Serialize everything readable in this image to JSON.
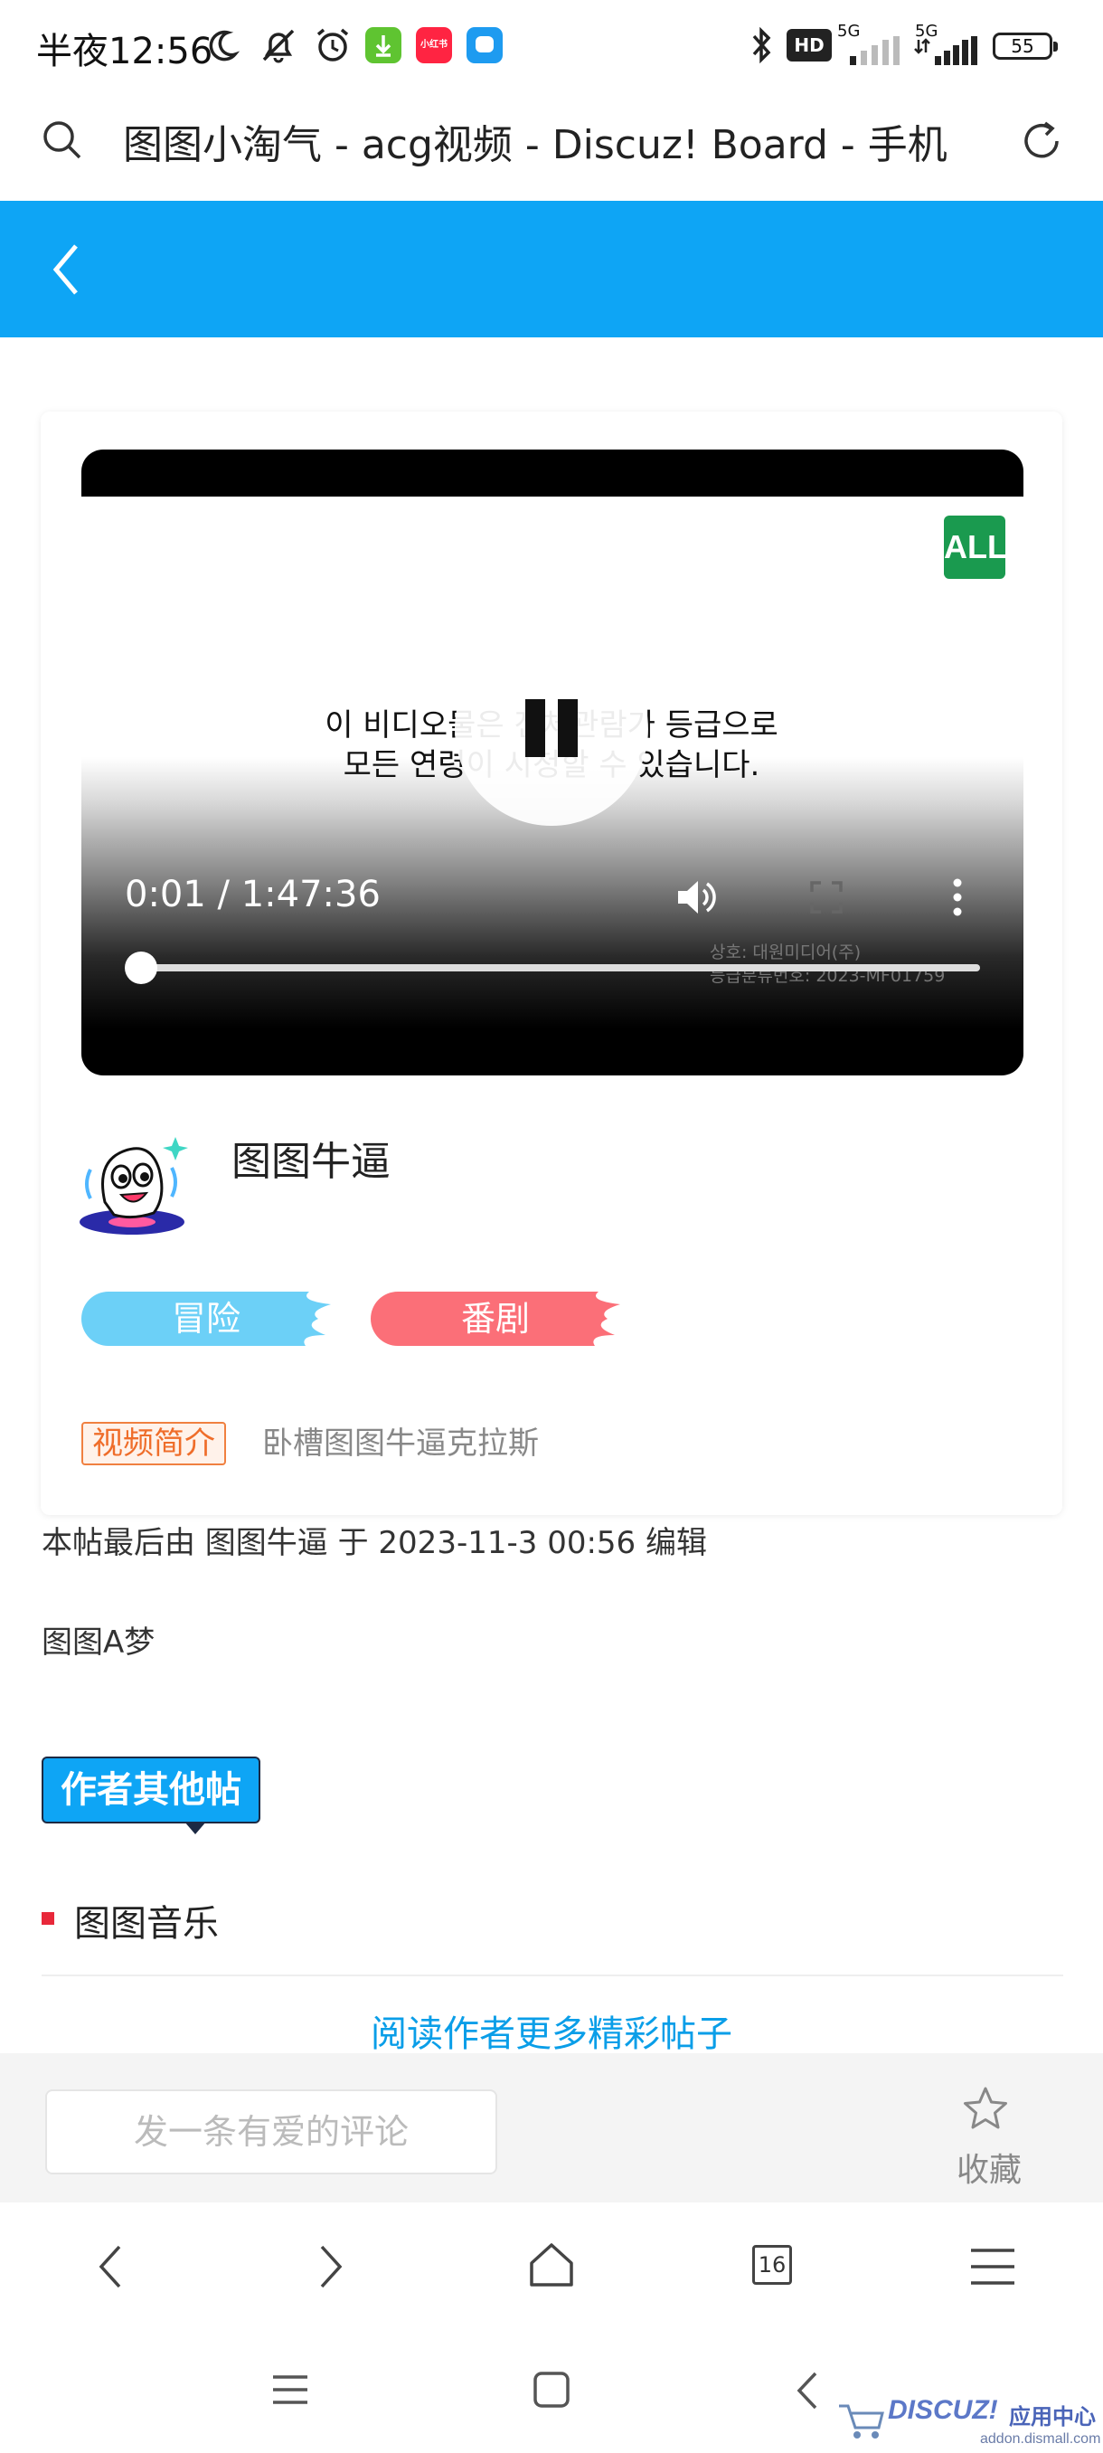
{
  "status_bar": {
    "time": "半夜12:56",
    "network_1": "5G",
    "network_2": "5G",
    "hd_label": "HD",
    "battery": "55"
  },
  "browser": {
    "url_title": "图图小淘气 - acg视频 - Discuz! Board - 手机"
  },
  "video": {
    "rating_badge": "ALL",
    "notice_line1": "이 비디오물은 전체관람가 등급으로",
    "notice_line2": "모든 연령이 시청할 수 있습니다.",
    "time_display": "0:01 / 1:47:36",
    "overlay_line1": "상호: 대원미디어(주)",
    "overlay_line2": "등급분류번호: 2023-MF01759",
    "progress": 0.0002
  },
  "author": {
    "name": "图图牛逼"
  },
  "tags": [
    "冒险",
    "番剧"
  ],
  "intro": {
    "label": "视频简介",
    "text": "卧槽图图牛逼克拉斯"
  },
  "post": {
    "edit_note": "本帖最后由 图图牛逼 于 2023-11-3 00:56 编辑",
    "body": "图图A梦"
  },
  "other_posts": {
    "label": "作者其他帖",
    "items": [
      "图图音乐"
    ],
    "read_more": "阅读作者更多精彩帖子"
  },
  "comment_bar": {
    "placeholder": "发一条有爱的评论",
    "favorite_label": "收藏"
  },
  "browser_nav": {
    "tab_count": "16"
  },
  "watermark": {
    "brand": "DISCUZ!",
    "suffix": "应用中心",
    "site": "addon.dismall.com"
  },
  "colors": {
    "header_blue": "#0ea5f5",
    "tag_adventure": "#6cd0f7",
    "tag_anime": "#fb6f78",
    "intro_orange": "#ef6d2a",
    "link_blue": "#0a9ee8",
    "rating_green": "#1a9a4f"
  }
}
